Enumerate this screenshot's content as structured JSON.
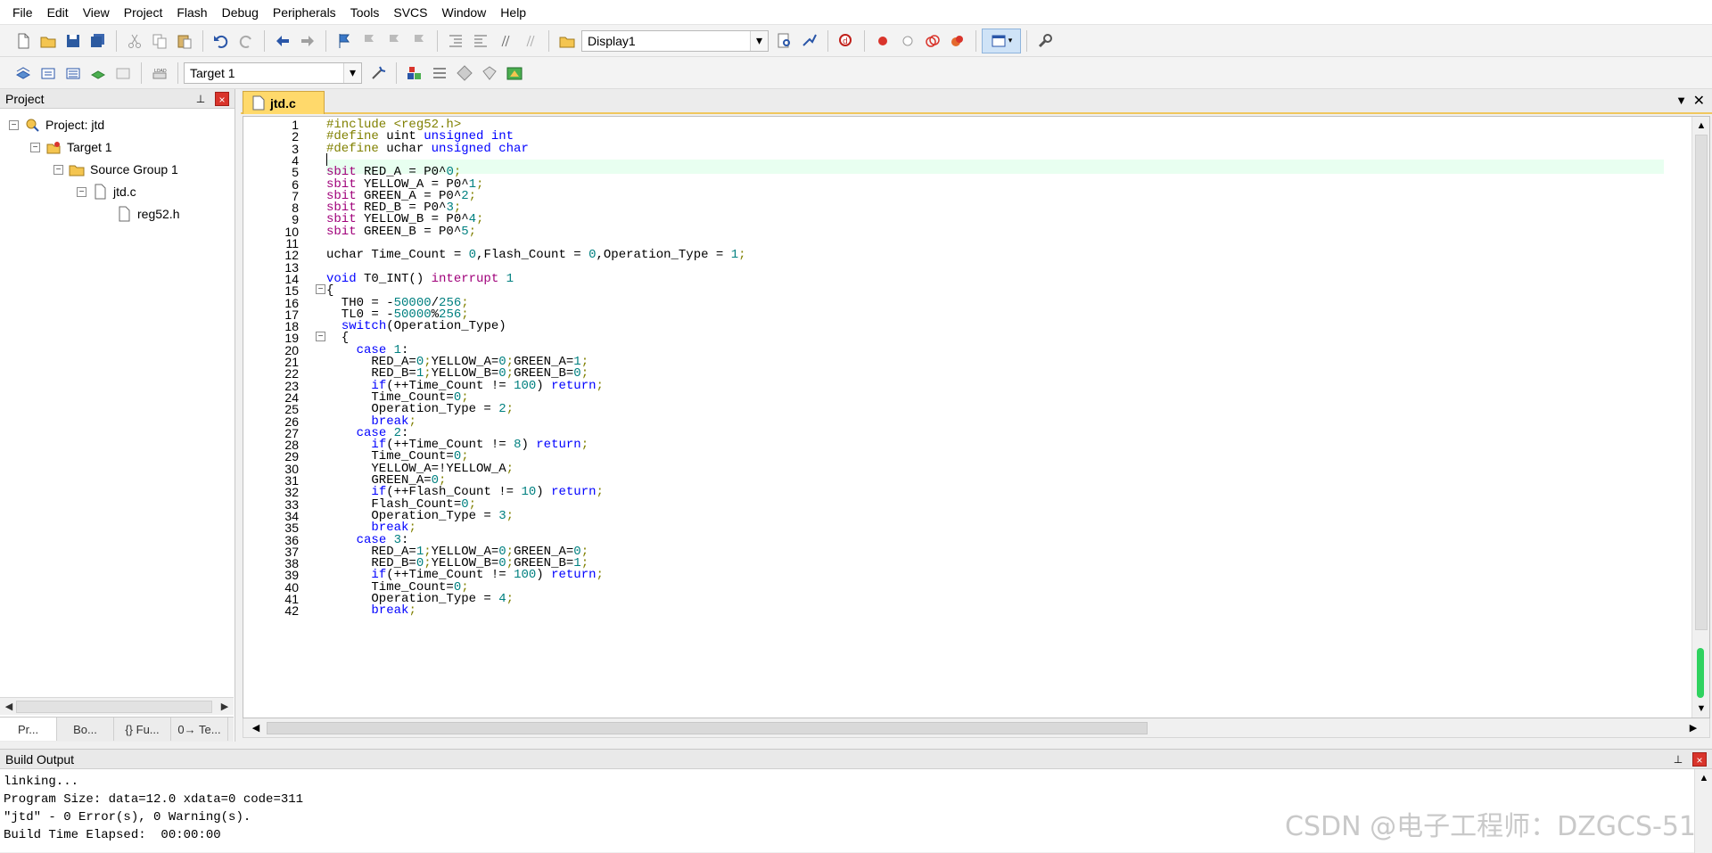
{
  "menu": [
    "File",
    "Edit",
    "View",
    "Project",
    "Flash",
    "Debug",
    "Peripherals",
    "Tools",
    "SVCS",
    "Window",
    "Help"
  ],
  "toolbar1": {
    "display_combo": "Display1"
  },
  "toolbar2": {
    "target_combo": "Target 1"
  },
  "project_panel": {
    "title": "Project",
    "tree": {
      "project": "Project: jtd",
      "target": "Target 1",
      "group": "Source Group 1",
      "file": "jtd.c",
      "header": "reg52.h"
    },
    "tabs": [
      "Pr...",
      "Bo...",
      "{} Fu...",
      "0→ Te..."
    ]
  },
  "editor": {
    "tab_label": "jtd.c",
    "line_numbers": [
      "1",
      "2",
      "3",
      "4",
      "5",
      "6",
      "7",
      "8",
      "9",
      "10",
      "11",
      "12",
      "13",
      "14",
      "15",
      "16",
      "17",
      "18",
      "19",
      "20",
      "21",
      "22",
      "23",
      "24",
      "25",
      "26",
      "27",
      "28",
      "29",
      "30",
      "31",
      "32",
      "33",
      "34",
      "35",
      "36",
      "37",
      "38",
      "39",
      "40",
      "41",
      "42"
    ],
    "code_lines": [
      "#include <reg52.h>",
      "#define uint unsigned int",
      "#define uchar unsigned char",
      "",
      "sbit RED_A = P0^0;",
      "sbit YELLOW_A = P0^1;",
      "sbit GREEN_A = P0^2;",
      "sbit RED_B = P0^3;",
      "sbit YELLOW_B = P0^4;",
      "sbit GREEN_B = P0^5;",
      "",
      "uchar Time_Count = 0,Flash_Count = 0,Operation_Type = 1;",
      "",
      "void T0_INT() interrupt 1",
      "{",
      "  TH0 = -50000/256;",
      "  TL0 = -50000%256;",
      "  switch(Operation_Type)",
      "  {",
      "    case 1:",
      "      RED_A=0;YELLOW_A=0;GREEN_A=1;",
      "      RED_B=1;YELLOW_B=0;GREEN_B=0;",
      "      if(++Time_Count != 100) return;",
      "      Time_Count=0;",
      "      Operation_Type = 2;",
      "      break;",
      "    case 2:",
      "      if(++Time_Count != 8) return;",
      "      Time_Count=0;",
      "      YELLOW_A=!YELLOW_A;",
      "      GREEN_A=0;",
      "      if(++Flash_Count != 10) return;",
      "      Flash_Count=0;",
      "      Operation_Type = 3;",
      "      break;",
      "    case 3:",
      "      RED_A=1;YELLOW_A=0;GREEN_A=0;",
      "      RED_B=0;YELLOW_B=0;GREEN_B=1;",
      "      if(++Time_Count != 100) return;",
      "      Time_Count=0;",
      "      Operation_Type = 4;",
      "      break;"
    ]
  },
  "build_output": {
    "title": "Build Output",
    "lines": [
      "linking...",
      "Program Size: data=12.0 xdata=0 code=311",
      "\"jtd\" - 0 Error(s), 0 Warning(s).",
      "Build Time Elapsed:  00:00:00"
    ]
  },
  "watermark": "CSDN @电子工程师：DZGCS-51",
  "colors": {
    "keyword": "#0000ff",
    "preprocessor": "#808000",
    "number": "#008080",
    "sbit": "#a0007a",
    "tab_active": "#ffd96b",
    "close_red": "#d9342b"
  }
}
